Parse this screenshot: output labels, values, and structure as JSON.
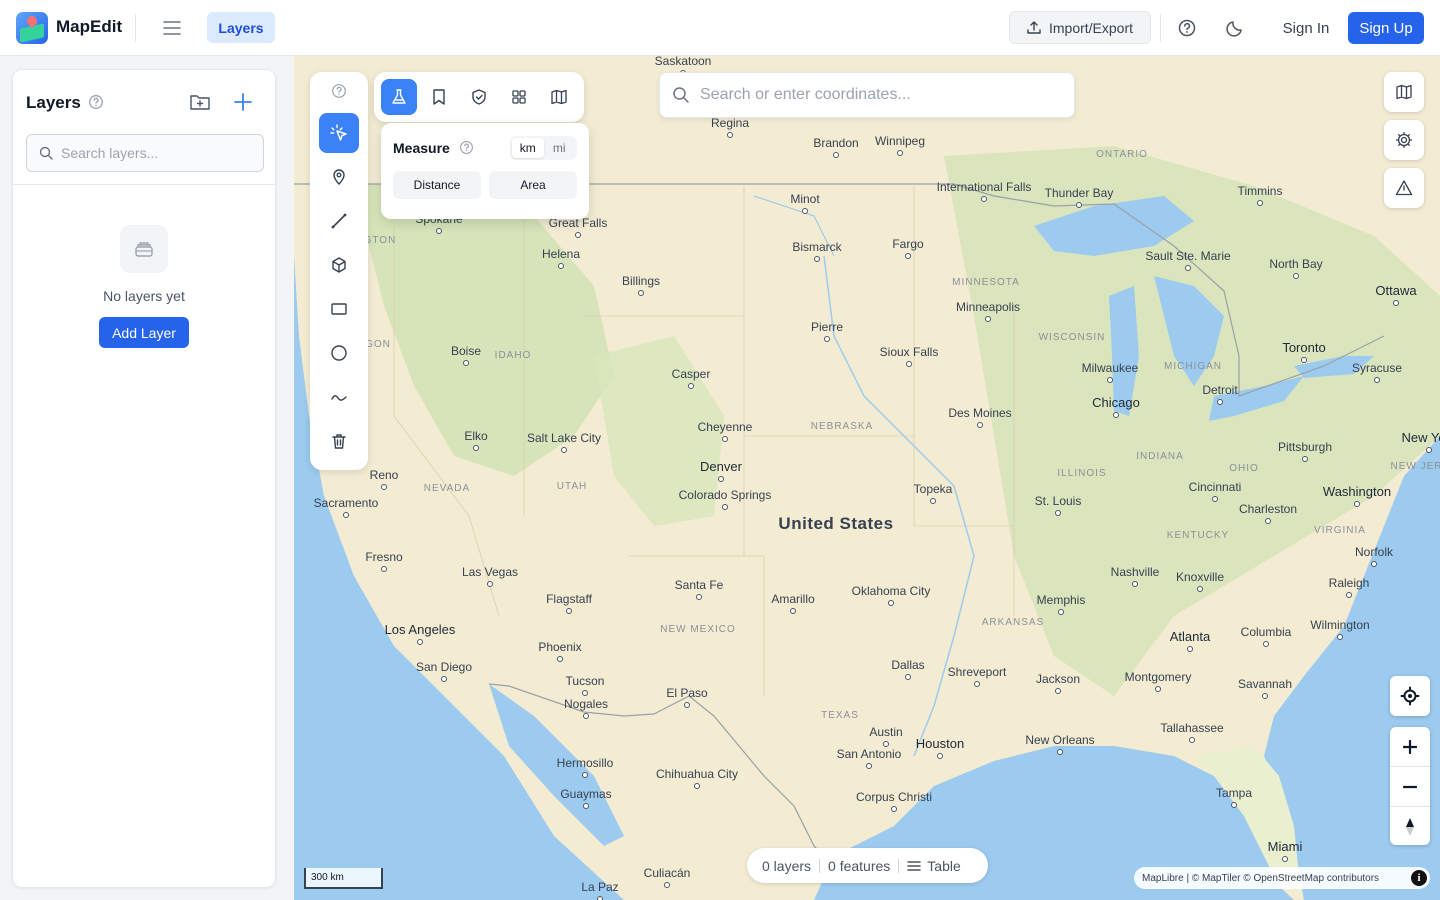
{
  "header": {
    "brand": "MapEdit",
    "layers_tab": "Layers",
    "import_export": "Import/Export",
    "sign_in": "Sign In",
    "sign_up": "Sign Up",
    "accent": "#2563eb"
  },
  "sidebar": {
    "title": "Layers",
    "search_placeholder": "Search layers...",
    "empty_text": "No layers yet",
    "add_layer": "Add Layer"
  },
  "map_search": {
    "placeholder": "Search or enter coordinates..."
  },
  "measure": {
    "title": "Measure",
    "unit_km": "km",
    "unit_mi": "mi",
    "selected_unit": "km",
    "distance": "Distance",
    "area": "Area"
  },
  "status_bar": {
    "layers": "0 layers",
    "features": "0 features",
    "table": "Table"
  },
  "scale": "300 km",
  "attribution": "MapLibre | © MapTiler © OpenStreetMap contributors",
  "map_labels": {
    "country": "United States",
    "cities": [
      "Saskatoon",
      "Regina",
      "Brandon",
      "Winnipeg",
      "Minot",
      "Bismarck",
      "Fargo",
      "Great Falls",
      "Helena",
      "Spokane",
      "Billings",
      "Boise",
      "Pierre",
      "Sioux Falls",
      "Minneapolis",
      "Casper",
      "Cheyenne",
      "Salt Lake City",
      "Elko",
      "Reno",
      "Sacramento",
      "Denver",
      "Colorado Springs",
      "Fresno",
      "Las Vegas",
      "Santa Fe",
      "Amarillo",
      "Oklahoma City",
      "Flagstaff",
      "Los Angeles",
      "San Diego",
      "Phoenix",
      "Tucson",
      "Nogales",
      "El Paso",
      "Dallas",
      "Shreveport",
      "Austin",
      "Houston",
      "San Antonio",
      "Hermosillo",
      "Chihuahua City",
      "Guaymas",
      "Corpus Christi",
      "Culiacán",
      "La Paz",
      "Topeka",
      "Des Moines",
      "St. Louis",
      "Chicago",
      "Milwaukee",
      "Detroit",
      "Toronto",
      "Ottawa",
      "Thunder Bay",
      "Sault Ste. Marie",
      "North Bay",
      "Timmins",
      "International Falls",
      "Syracuse",
      "New York",
      "Pittsburgh",
      "Washington",
      "Cincinnati",
      "Charleston",
      "Nashville",
      "Knoxville",
      "Memphis",
      "Atlanta",
      "Columbia",
      "Raleigh",
      "Norfolk",
      "Wilmington",
      "Montgomery",
      "Jackson",
      "New Orleans",
      "Tallahassee",
      "Savannah",
      "Tampa",
      "Miami"
    ],
    "states": [
      "ONTARIO",
      "MINNESOTA",
      "WISCONSIN",
      "MICHIGAN",
      "IDAHO",
      "NEBRASKA",
      "NEVADA",
      "UTAH",
      "ILLINOIS",
      "INDIANA",
      "OHIO",
      "KENTUCKY",
      "VIRGINIA",
      "NEW MEXICO",
      "TEXAS",
      "ARKANSAS",
      "NEW JERSEY",
      "SHINGTON",
      "GON"
    ]
  }
}
